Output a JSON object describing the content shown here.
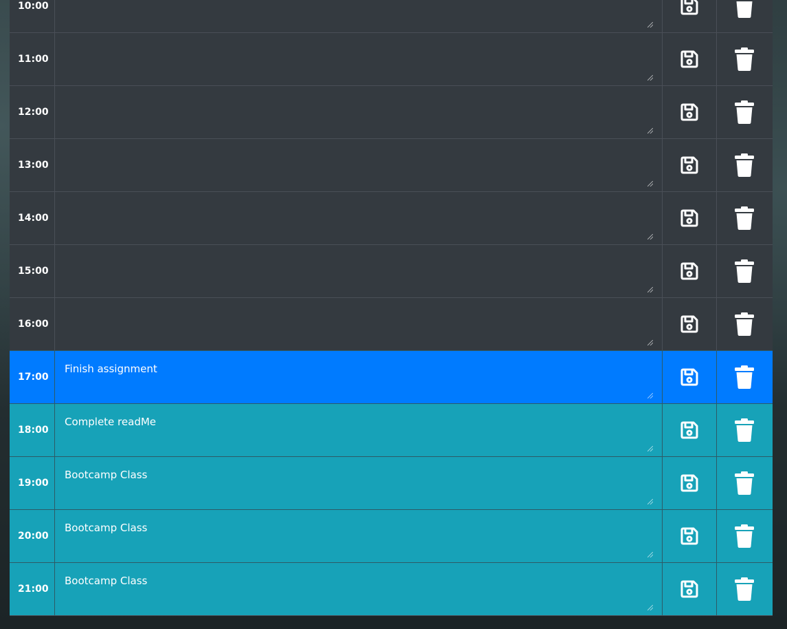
{
  "planner": {
    "rows": [
      {
        "hour": "10:00",
        "text": "",
        "state": "past"
      },
      {
        "hour": "11:00",
        "text": "",
        "state": "past"
      },
      {
        "hour": "12:00",
        "text": "",
        "state": "past"
      },
      {
        "hour": "13:00",
        "text": "",
        "state": "past"
      },
      {
        "hour": "14:00",
        "text": "",
        "state": "past"
      },
      {
        "hour": "15:00",
        "text": "",
        "state": "past"
      },
      {
        "hour": "16:00",
        "text": "",
        "state": "past"
      },
      {
        "hour": "17:00",
        "text": "Finish assignment",
        "state": "present"
      },
      {
        "hour": "18:00",
        "text": "Complete readMe",
        "state": "future"
      },
      {
        "hour": "19:00",
        "text": "Bootcamp Class",
        "state": "future"
      },
      {
        "hour": "20:00",
        "text": "Bootcamp Class",
        "state": "future"
      },
      {
        "hour": "21:00",
        "text": "Bootcamp Class",
        "state": "future"
      }
    ],
    "icons": {
      "save": "floppy-disk-icon",
      "delete": "trash-icon"
    },
    "colors": {
      "past": "#343a40",
      "present": "#007bff",
      "future": "#17a2b8",
      "text": "#ffffff"
    }
  }
}
